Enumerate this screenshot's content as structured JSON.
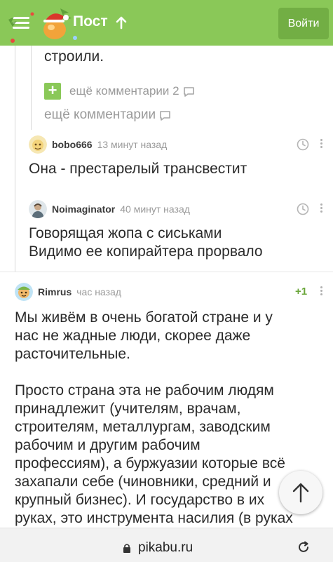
{
  "header": {
    "title": "Пост",
    "login_label": "Войти",
    "icons": [
      "menu-icon",
      "pikabu-logo",
      "up-arrow-icon"
    ]
  },
  "thread": {
    "prev_tail": "строили.",
    "more_nested": "ещё комментарии 2",
    "more": "ещё комментарии"
  },
  "comments": [
    {
      "author": "bobo666",
      "time": "13 минут назад",
      "text": "Она - престарелый трансвестит"
    },
    {
      "author": "Noimaginator",
      "time": "40 минут назад",
      "line1": "Говорящая жопа с сиськами",
      "line2": "Видимо ее копирайтера прорвало"
    },
    {
      "author": "Rimrus",
      "time": "час назад",
      "rating": "+1",
      "p1": [
        "Мы живём в очень богатой стране и у",
        "нас не жадные люди, скорее даже",
        "расточительные."
      ],
      "p2": [
        "Просто страна эта не рабочим людям",
        "принадлежит (учителям, врачам,",
        "строителям, металлургам, заводским",
        "рабочим и другим рабочим",
        "профессиям), а буржуазии которые всё",
        "захапали себе (чиновники, средний и",
        "крупный бизнес). И государство в их",
        "руках, это инструмента насилия (в руках"
      ]
    }
  ],
  "browser": {
    "url": "pikabu.ru"
  },
  "colors": {
    "brand_green": "#8ac858",
    "button_green": "#72ae44",
    "rating_green": "#6aa63a"
  }
}
